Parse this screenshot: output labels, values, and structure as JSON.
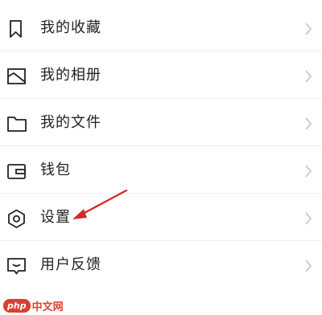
{
  "menu": {
    "items": [
      {
        "label": "我的收藏",
        "icon": "bookmark-icon"
      },
      {
        "label": "我的相册",
        "icon": "image-icon"
      },
      {
        "label": "我的文件",
        "icon": "folder-icon"
      },
      {
        "label": "钱包",
        "icon": "wallet-icon"
      },
      {
        "label": "设置",
        "icon": "settings-icon"
      },
      {
        "label": "用户反馈",
        "icon": "feedback-icon"
      }
    ]
  },
  "annotation": {
    "color": "#d42a2a",
    "target": "设置"
  },
  "watermark": {
    "badge": "php",
    "site": "中文网"
  }
}
